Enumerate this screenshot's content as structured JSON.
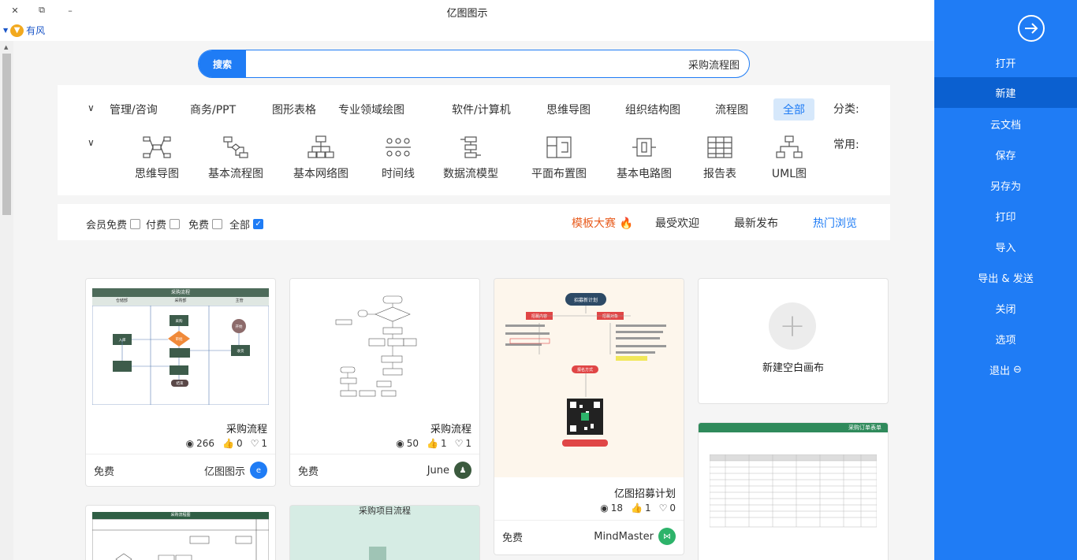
{
  "window": {
    "title": "亿图图示",
    "controls": {
      "close": "✕",
      "restore": "⧉",
      "minimize": "–"
    }
  },
  "user": {
    "name": "有风"
  },
  "search": {
    "button": "搜索",
    "value": "采购流程图"
  },
  "categories": {
    "label": "分类:",
    "items": [
      "全部",
      "流程图",
      "组织结构图",
      "思维导图",
      "软件/计算机",
      "专业领域绘图",
      "图形表格",
      "商务/PPT",
      "管理/咨询"
    ]
  },
  "common": {
    "label": "常用:",
    "items": [
      "UML图",
      "报告表",
      "基本电路图",
      "平面布置图",
      "数据流模型",
      "时间线",
      "基本网络图",
      "基本流程图",
      "思维导图"
    ]
  },
  "filter": {
    "tabs": [
      "热门浏览",
      "最受欢迎",
      "最新发布",
      "模板大赛"
    ],
    "checks": [
      "全部",
      "免费",
      "付费",
      "会员免费"
    ]
  },
  "new_canvas": {
    "label": "新建空白画布"
  },
  "cards": [
    {
      "title": "亿图招募计划",
      "views": "18",
      "likes": "1",
      "favs": "0",
      "author": "MindMaster",
      "price": "免费",
      "thumb": {
        "banner": "招募新计划",
        "left_tag": "招募对象",
        "right_tag": "招募内容",
        "bottom_tag": "报名方式"
      }
    },
    {
      "title": "采购流程",
      "views": "50",
      "likes": "1",
      "favs": "1",
      "author": "June",
      "price": "免费"
    },
    {
      "title": "采购流程",
      "views": "266",
      "likes": "0",
      "favs": "1",
      "author": "亿图图示",
      "price": "免费",
      "thumb": {
        "header": "采购流程",
        "lanes": [
          "仓储部",
          "采购部",
          "主管"
        ],
        "node_labels": [
          "采购",
          "开始",
          "收货",
          "审批",
          "入库",
          "结束"
        ]
      }
    },
    {
      "thumb": {
        "header": "采购订单表单"
      }
    },
    {
      "thumb": {
        "header": "采购项目流程"
      }
    },
    {
      "thumb": {
        "header": "采购流程图"
      }
    }
  ],
  "sidebar": {
    "items": [
      "打开",
      "新建",
      "云文档",
      "保存",
      "另存为",
      "打印",
      "导入",
      "导出 & 发送",
      "关闭",
      "选项",
      "退出"
    ],
    "active_index": 1
  },
  "colors": {
    "accent": "#1f7cf5",
    "sidebar_active": "#0b60d0",
    "hot": "#e85c1e"
  }
}
